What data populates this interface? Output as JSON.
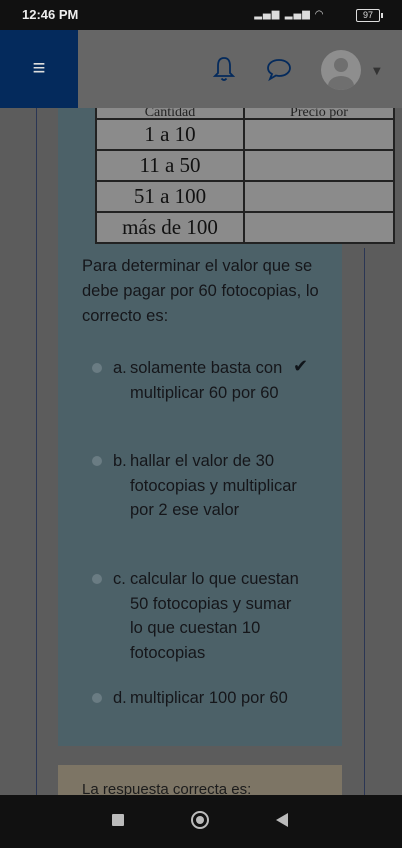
{
  "status": {
    "time": "12:46 PM",
    "battery": "97"
  },
  "nav": {
    "menu_icon": "≡",
    "caret": "▼"
  },
  "table": {
    "header": [
      "Cantidad",
      "Precio por"
    ],
    "rows": [
      "1 a 10",
      "11 a 50",
      "51 a 100",
      "más de 100"
    ]
  },
  "question": {
    "text": "Para determinar el valor que se debe pagar por 60 fotocopias, lo correcto es:",
    "options": [
      {
        "letter": "a.",
        "text": "solamente basta con multiplicar 60 por 60"
      },
      {
        "letter": "b.",
        "text": "hallar el valor de 30 fotocopias y multiplicar por 2 ese valor"
      },
      {
        "letter": "c.",
        "text": "calcular lo que cuestan 50 fotocopias y sumar lo que cuestan 10 fotocopias"
      },
      {
        "letter": "d.",
        "text": "multiplicar 100 por 60"
      }
    ],
    "check": "✔"
  },
  "feedback": {
    "text": "La respuesta correcta es:"
  }
}
